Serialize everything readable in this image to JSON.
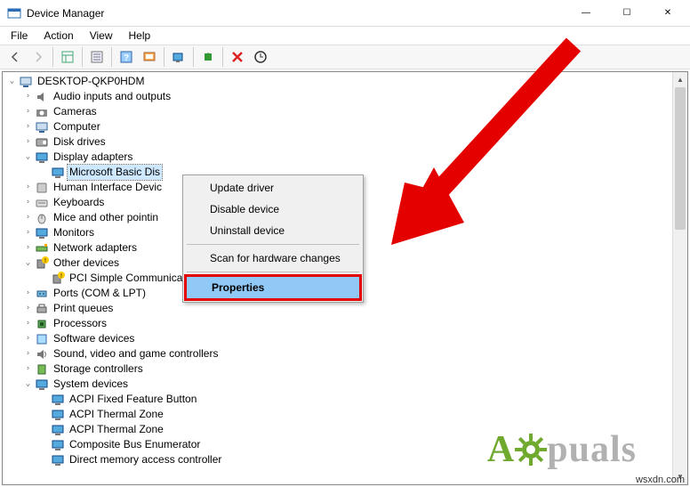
{
  "window": {
    "title": "Device Manager"
  },
  "window_controls": {
    "min": "—",
    "max": "☐",
    "close": "✕"
  },
  "menubar": {
    "file": "File",
    "action": "Action",
    "view": "View",
    "help": "Help"
  },
  "tree": {
    "root": "DESKTOP-QKP0HDM",
    "items": [
      {
        "label": "Audio inputs and outputs"
      },
      {
        "label": "Cameras"
      },
      {
        "label": "Computer"
      },
      {
        "label": "Disk drives"
      },
      {
        "label": "Display adapters"
      },
      {
        "label": "Microsoft Basic Dis"
      },
      {
        "label": "Human Interface Devic"
      },
      {
        "label": "Keyboards"
      },
      {
        "label": "Mice and other pointin"
      },
      {
        "label": "Monitors"
      },
      {
        "label": "Network adapters"
      },
      {
        "label": "Other devices"
      },
      {
        "label": "PCI Simple Communications Controller"
      },
      {
        "label": "Ports (COM & LPT)"
      },
      {
        "label": "Print queues"
      },
      {
        "label": "Processors"
      },
      {
        "label": "Software devices"
      },
      {
        "label": "Sound, video and game controllers"
      },
      {
        "label": "Storage controllers"
      },
      {
        "label": "System devices"
      },
      {
        "label": "ACPI Fixed Feature Button"
      },
      {
        "label": "ACPI Thermal Zone"
      },
      {
        "label": "ACPI Thermal Zone"
      },
      {
        "label": "Composite Bus Enumerator"
      },
      {
        "label": "Direct memory access controller"
      }
    ]
  },
  "context_menu": {
    "items": [
      "Update driver",
      "Disable device",
      "Uninstall device",
      "Scan for hardware changes",
      "Properties"
    ]
  },
  "logo_text": {
    "a": "A",
    "puals": "puals"
  },
  "watermark": "wsxdn.com"
}
